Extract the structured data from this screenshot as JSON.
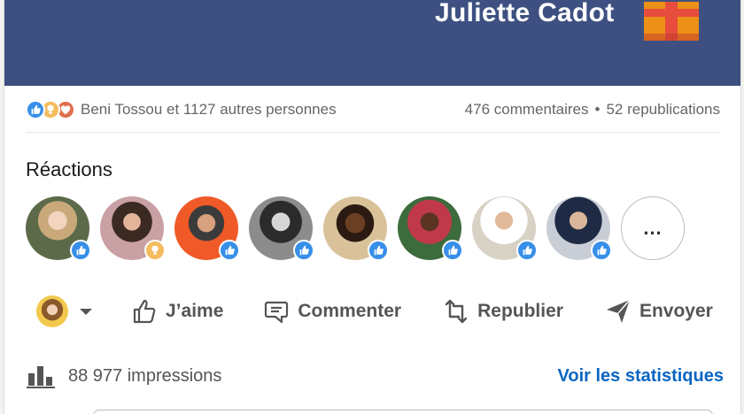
{
  "banner": {
    "name": "Juliette Cadot"
  },
  "social": {
    "reaction_icons": [
      "like-icon",
      "insightful-icon",
      "love-icon"
    ],
    "names": "Beni Tossou et 1127 autres personnes",
    "comments": "476 commentaires",
    "separator": "•",
    "reposts": "52 republications"
  },
  "reactions": {
    "title": "Réactions",
    "avatars": [
      {
        "badge": "like"
      },
      {
        "badge": "insight"
      },
      {
        "badge": "like"
      },
      {
        "badge": "like"
      },
      {
        "badge": "like"
      },
      {
        "badge": "like"
      },
      {
        "badge": "like"
      },
      {
        "badge": "like"
      }
    ],
    "more_label": "..."
  },
  "actions": {
    "like": "J’aime",
    "comment": "Commenter",
    "repost": "Republier",
    "send": "Envoyer"
  },
  "stats": {
    "impressions": "88 977 impressions",
    "link": "Voir les statistiques"
  },
  "colors": {
    "banner": "#3d5081",
    "link": "#0a66c2",
    "like": "#378fe9",
    "insight": "#f5bb5c",
    "love": "#df704d"
  }
}
